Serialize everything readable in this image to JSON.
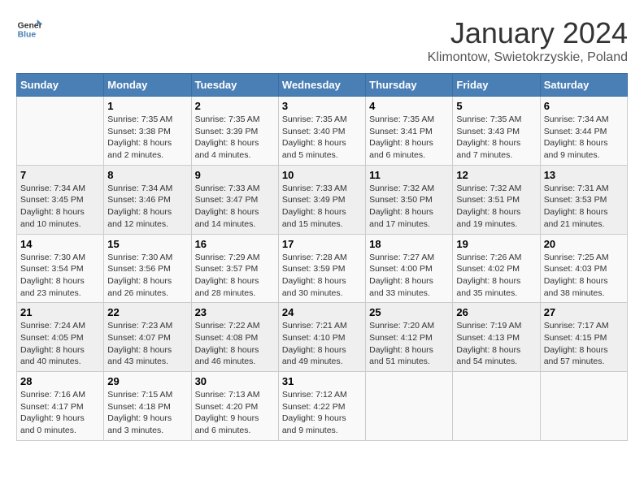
{
  "header": {
    "logo_line1": "General",
    "logo_line2": "Blue",
    "title": "January 2024",
    "subtitle": "Klimontow, Swietokrzyskie, Poland"
  },
  "weekdays": [
    "Sunday",
    "Monday",
    "Tuesday",
    "Wednesday",
    "Thursday",
    "Friday",
    "Saturday"
  ],
  "weeks": [
    [
      {
        "day": "",
        "info": ""
      },
      {
        "day": "1",
        "info": "Sunrise: 7:35 AM\nSunset: 3:38 PM\nDaylight: 8 hours\nand 2 minutes."
      },
      {
        "day": "2",
        "info": "Sunrise: 7:35 AM\nSunset: 3:39 PM\nDaylight: 8 hours\nand 4 minutes."
      },
      {
        "day": "3",
        "info": "Sunrise: 7:35 AM\nSunset: 3:40 PM\nDaylight: 8 hours\nand 5 minutes."
      },
      {
        "day": "4",
        "info": "Sunrise: 7:35 AM\nSunset: 3:41 PM\nDaylight: 8 hours\nand 6 minutes."
      },
      {
        "day": "5",
        "info": "Sunrise: 7:35 AM\nSunset: 3:43 PM\nDaylight: 8 hours\nand 7 minutes."
      },
      {
        "day": "6",
        "info": "Sunrise: 7:34 AM\nSunset: 3:44 PM\nDaylight: 8 hours\nand 9 minutes."
      }
    ],
    [
      {
        "day": "7",
        "info": "Sunrise: 7:34 AM\nSunset: 3:45 PM\nDaylight: 8 hours\nand 10 minutes."
      },
      {
        "day": "8",
        "info": "Sunrise: 7:34 AM\nSunset: 3:46 PM\nDaylight: 8 hours\nand 12 minutes."
      },
      {
        "day": "9",
        "info": "Sunrise: 7:33 AM\nSunset: 3:47 PM\nDaylight: 8 hours\nand 14 minutes."
      },
      {
        "day": "10",
        "info": "Sunrise: 7:33 AM\nSunset: 3:49 PM\nDaylight: 8 hours\nand 15 minutes."
      },
      {
        "day": "11",
        "info": "Sunrise: 7:32 AM\nSunset: 3:50 PM\nDaylight: 8 hours\nand 17 minutes."
      },
      {
        "day": "12",
        "info": "Sunrise: 7:32 AM\nSunset: 3:51 PM\nDaylight: 8 hours\nand 19 minutes."
      },
      {
        "day": "13",
        "info": "Sunrise: 7:31 AM\nSunset: 3:53 PM\nDaylight: 8 hours\nand 21 minutes."
      }
    ],
    [
      {
        "day": "14",
        "info": "Sunrise: 7:30 AM\nSunset: 3:54 PM\nDaylight: 8 hours\nand 23 minutes."
      },
      {
        "day": "15",
        "info": "Sunrise: 7:30 AM\nSunset: 3:56 PM\nDaylight: 8 hours\nand 26 minutes."
      },
      {
        "day": "16",
        "info": "Sunrise: 7:29 AM\nSunset: 3:57 PM\nDaylight: 8 hours\nand 28 minutes."
      },
      {
        "day": "17",
        "info": "Sunrise: 7:28 AM\nSunset: 3:59 PM\nDaylight: 8 hours\nand 30 minutes."
      },
      {
        "day": "18",
        "info": "Sunrise: 7:27 AM\nSunset: 4:00 PM\nDaylight: 8 hours\nand 33 minutes."
      },
      {
        "day": "19",
        "info": "Sunrise: 7:26 AM\nSunset: 4:02 PM\nDaylight: 8 hours\nand 35 minutes."
      },
      {
        "day": "20",
        "info": "Sunrise: 7:25 AM\nSunset: 4:03 PM\nDaylight: 8 hours\nand 38 minutes."
      }
    ],
    [
      {
        "day": "21",
        "info": "Sunrise: 7:24 AM\nSunset: 4:05 PM\nDaylight: 8 hours\nand 40 minutes."
      },
      {
        "day": "22",
        "info": "Sunrise: 7:23 AM\nSunset: 4:07 PM\nDaylight: 8 hours\nand 43 minutes."
      },
      {
        "day": "23",
        "info": "Sunrise: 7:22 AM\nSunset: 4:08 PM\nDaylight: 8 hours\nand 46 minutes."
      },
      {
        "day": "24",
        "info": "Sunrise: 7:21 AM\nSunset: 4:10 PM\nDaylight: 8 hours\nand 49 minutes."
      },
      {
        "day": "25",
        "info": "Sunrise: 7:20 AM\nSunset: 4:12 PM\nDaylight: 8 hours\nand 51 minutes."
      },
      {
        "day": "26",
        "info": "Sunrise: 7:19 AM\nSunset: 4:13 PM\nDaylight: 8 hours\nand 54 minutes."
      },
      {
        "day": "27",
        "info": "Sunrise: 7:17 AM\nSunset: 4:15 PM\nDaylight: 8 hours\nand 57 minutes."
      }
    ],
    [
      {
        "day": "28",
        "info": "Sunrise: 7:16 AM\nSunset: 4:17 PM\nDaylight: 9 hours\nand 0 minutes."
      },
      {
        "day": "29",
        "info": "Sunrise: 7:15 AM\nSunset: 4:18 PM\nDaylight: 9 hours\nand 3 minutes."
      },
      {
        "day": "30",
        "info": "Sunrise: 7:13 AM\nSunset: 4:20 PM\nDaylight: 9 hours\nand 6 minutes."
      },
      {
        "day": "31",
        "info": "Sunrise: 7:12 AM\nSunset: 4:22 PM\nDaylight: 9 hours\nand 9 minutes."
      },
      {
        "day": "",
        "info": ""
      },
      {
        "day": "",
        "info": ""
      },
      {
        "day": "",
        "info": ""
      }
    ]
  ]
}
